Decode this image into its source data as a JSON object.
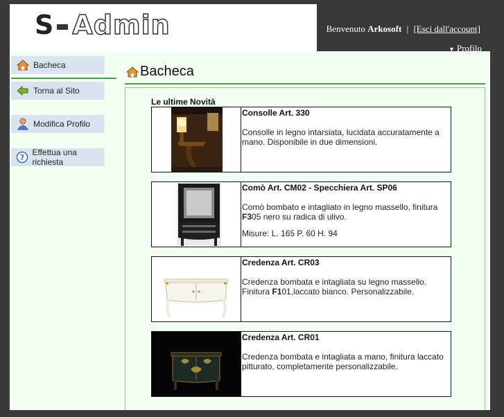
{
  "header": {
    "logo_s": "S",
    "logo_admin": "Admin",
    "welcome_prefix": "Benvenuto",
    "username": "Arkosoft",
    "separator": "|",
    "logout_label": "[Esci dall'account]",
    "profile_label": "Profilo"
  },
  "sidebar": {
    "items": [
      {
        "label": "Bacheca",
        "icon": "home-icon"
      },
      {
        "label": "Torna al Sito",
        "icon": "arrow-left-icon"
      },
      {
        "label": "Modifica Profilo",
        "icon": "user-icon"
      },
      {
        "label": "Effettua una richiesta",
        "icon": "help-icon"
      }
    ]
  },
  "main": {
    "title": "Bacheca",
    "section_label": "Le ultime Novità",
    "products": [
      {
        "name": "Consolle Art. 330",
        "desc": "Consolle in legno intarsiata, lucidata accuratamente a mano. Disponibile in due dimensioni."
      },
      {
        "name": "Comò Art. CM02 - Specchiera Art. SP06",
        "desc_pre": "Comò bombato e intagliato in legno massello, finitura ",
        "desc_bold": "F3",
        "desc_post": "05 nero su radica di ulivo.",
        "extra": "Misure: L. 165  P. 60  H. 94"
      },
      {
        "name": "Credenza Art. CR03",
        "desc_pre": "Credenza bombata e intagliata su legno massello. Finitura ",
        "desc_bold": "F1",
        "desc_post": "01,laccato bianco. Personalizzabile."
      },
      {
        "name": "Credenza Art. CR01",
        "desc": "Credenza bombata e intagliata a mano, finitura laccato pitturato, completamente personalizzabile."
      }
    ]
  },
  "colors": {
    "page_bg": "#3a3a3a",
    "content_bg": "#f3fff3",
    "topbar_bg": "#383838",
    "sidebar_item_bg": "#d9e4ef",
    "accent_green": "#4b9a4b"
  }
}
